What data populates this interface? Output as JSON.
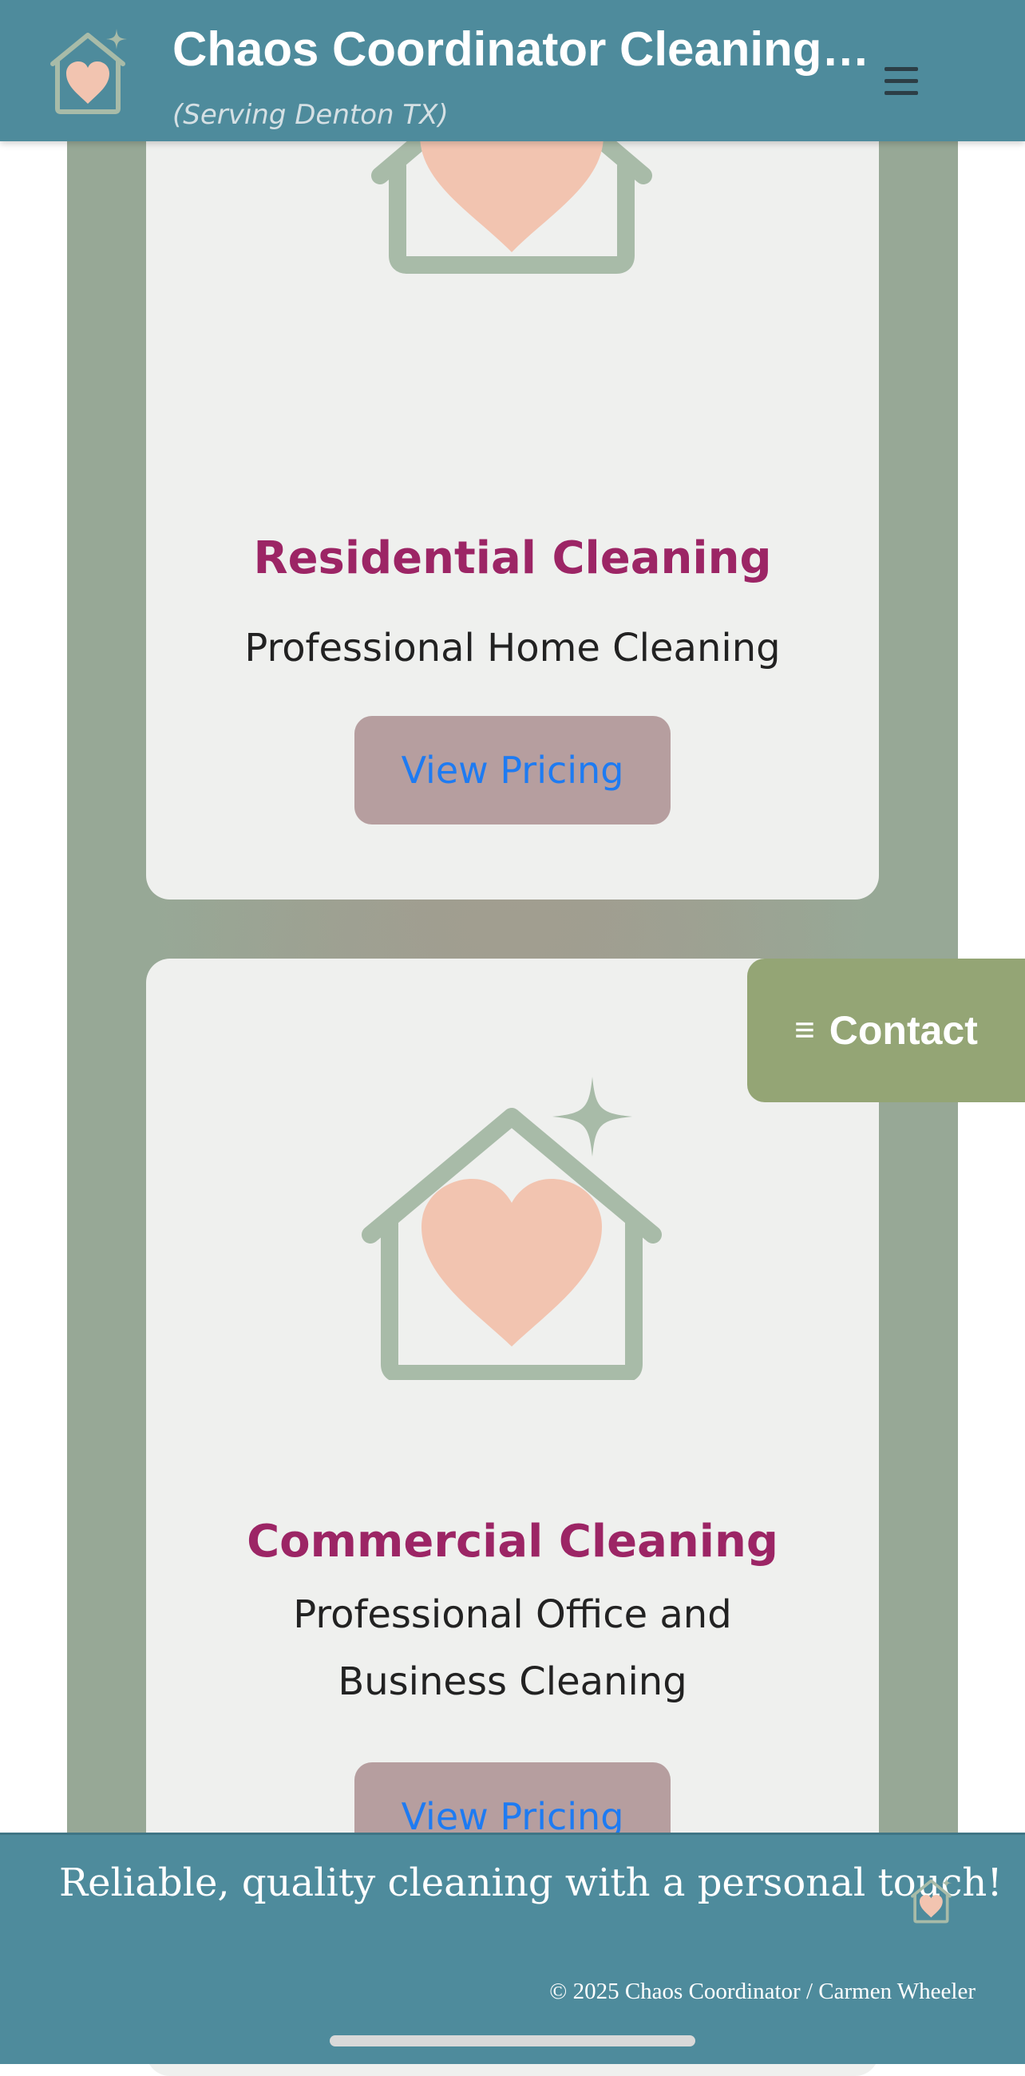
{
  "header": {
    "title": "Chaos Coordinator Cleaning …",
    "subtitle": "(Serving Denton TX)",
    "logo_icon": "house-heart-sparkle-icon",
    "menu_icon": "hamburger-menu-icon"
  },
  "services": [
    {
      "icon": "house-heart-sparkle-icon",
      "title": "Residential Cleaning",
      "description": "Professional Home Cleaning",
      "button_label": "View Pricing"
    },
    {
      "icon": "house-heart-sparkle-icon",
      "title": "Commercial Cleaning",
      "description_lines": [
        "Professional Office and",
        "Business Cleaning"
      ],
      "button_label": "View Pricing"
    }
  ],
  "contact_tab": {
    "icon": "≡",
    "label": "Contact"
  },
  "footer": {
    "tagline": "Reliable, quality cleaning with a personal touch!",
    "copyright": "© 2025 Chaos Coordinator / Carmen Wheeler",
    "logo_icon": "house-heart-sparkle-icon"
  },
  "colors": {
    "header_bg": "#4e8b9c",
    "panel_bg": "#97a896",
    "card_bg": "#eff0ee",
    "title_color": "#9c2565",
    "button_bg": "#b69e9f",
    "button_text": "#1e7bf2",
    "contact_bg": "#94a575",
    "icon_house": "#a8bba8",
    "icon_heart": "#f2c4b0"
  }
}
